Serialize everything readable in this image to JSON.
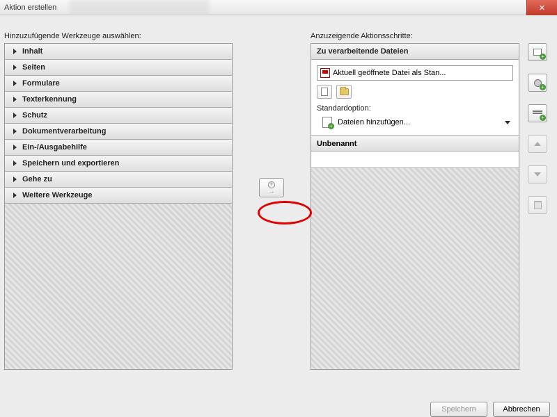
{
  "window": {
    "title": "Aktion erstellen"
  },
  "left": {
    "label": "Hinzuzufügende Werkzeuge auswählen:",
    "categories": [
      "Inhalt",
      "Seiten",
      "Formulare",
      "Texterkennung",
      "Schutz",
      "Dokumentverarbeitung",
      "Ein-/Ausgabehilfe",
      "Speichern und exportieren",
      "Gehe zu",
      "Weitere Werkzeuge"
    ]
  },
  "right": {
    "label": "Anzuzeigende Aktionsschritte:",
    "files_header": "Zu verarbeitende Dateien",
    "current_file": "Aktuell geöffnete Datei als Stan...",
    "standard_label": "Standardoption:",
    "add_files": "Dateien hinzufügen...",
    "unnamed": "Unbenannt"
  },
  "buttons": {
    "save": "Speichern",
    "cancel": "Abbrechen"
  }
}
